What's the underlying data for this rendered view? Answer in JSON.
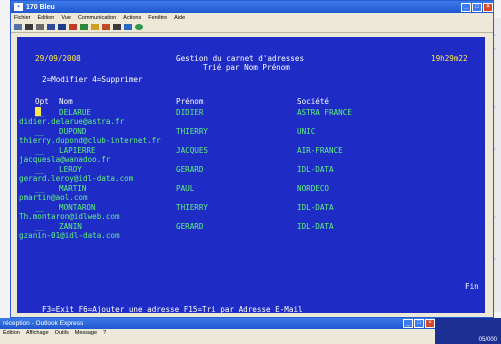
{
  "window": {
    "title": "170 Bleu",
    "menu": [
      "Fichier",
      "Édition",
      "Vue",
      "Communication",
      "Actions",
      "Fenêtre",
      "Aide"
    ],
    "controls": {
      "minimize": "_",
      "maximize": "□",
      "close": "×"
    }
  },
  "toolbar": {
    "icons": [
      "screen-icon",
      "copy-icon",
      "paste-icon",
      "print-icon",
      "grid-icon",
      "send-icon",
      "receive-icon",
      "macro-icon",
      "record-icon",
      "settings-icon",
      "help-icon",
      "globe-icon"
    ]
  },
  "terminal": {
    "date": "29/09/2008",
    "title": "Gestion du carnet d'adresses",
    "time": "19h29m22",
    "subtitle": "Trié par Nom Prénom",
    "options": "2=Modifier  4=Supprimer",
    "headers": {
      "opt": "Opt",
      "nom": "Nom",
      "prenom": "Prénom",
      "societe": "Société"
    },
    "rows": [
      {
        "opt": "__",
        "nom": "DELARUE",
        "prenom": "DIDIER",
        "societe": "ASTRA FRANCE",
        "email": "didier.delarue@astra.fr"
      },
      {
        "opt": "__",
        "nom": "DUPOND",
        "prenom": "THIERRY",
        "societe": "UNIC",
        "email": "thierry.dupond@club-internet.fr"
      },
      {
        "opt": "__",
        "nom": "LAPIERRE",
        "prenom": "JACQUES",
        "societe": "AIR-FRANCE",
        "email": "jacquesla@wanadoo.fr"
      },
      {
        "opt": "__",
        "nom": "LEROY",
        "prenom": "GERARD",
        "societe": "IDL-DATA",
        "email": "gerard.leroy@idl-data.com"
      },
      {
        "opt": "__",
        "nom": "MARTIN",
        "prenom": "PAUL",
        "societe": "NORDECO",
        "email": "pmartin@aol.com"
      },
      {
        "opt": "__",
        "nom": "MONTARON",
        "prenom": "THIERRY",
        "societe": "IDL-DATA",
        "email": "Th.montaron@idlweb.com"
      },
      {
        "opt": "__",
        "nom": "ZANIN",
        "prenom": "GERARD",
        "societe": "IDL-DATA",
        "email": "gzanin-01@idl-data.com"
      }
    ],
    "fin": "Fin",
    "footer": "F3=Exit  F6=Ajouter une adresse  F15=Tri par Adresse E-Mail"
  },
  "background_window": {
    "title": "réception - Outlook Express",
    "menu": [
      "Édition",
      "Affichage",
      "Outils",
      "Message",
      "?"
    ],
    "clock": "05/000"
  },
  "colors": {
    "terminal_bg": "#1e2cc5",
    "terminal_green": "#60f27b",
    "terminal_white": "#ffffff",
    "cursor": "#ffe94a"
  }
}
